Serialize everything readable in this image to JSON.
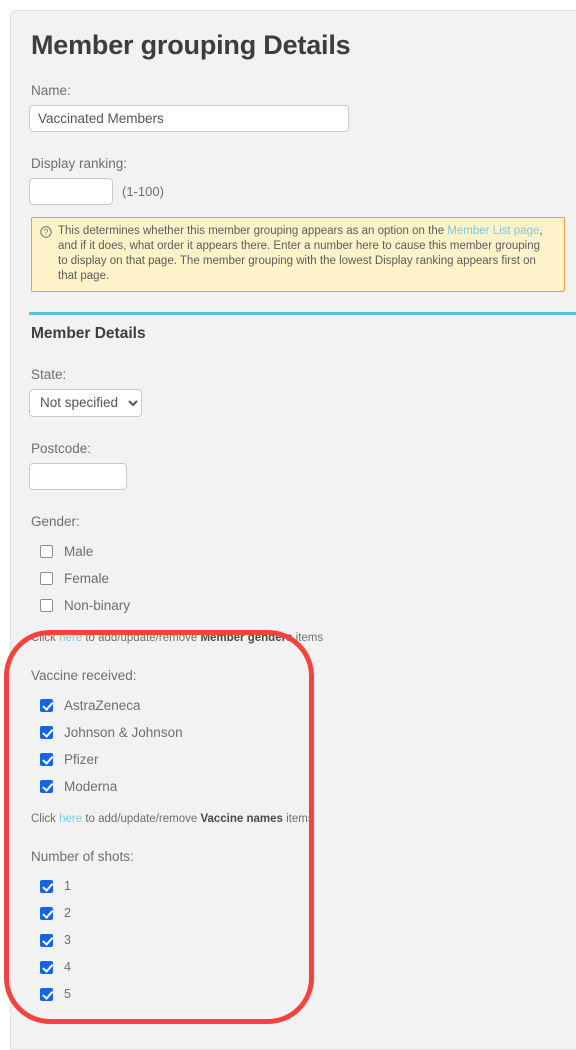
{
  "page": {
    "title": "Member grouping Details"
  },
  "name_field": {
    "label": "Name:",
    "value": "Vaccinated Members",
    "placeholder": ""
  },
  "ranking_field": {
    "label": "Display ranking:",
    "value": "",
    "placeholder": "",
    "hint": "(1-100)"
  },
  "info_box": {
    "icon": "question-circle-icon",
    "line1_pre": "This determines whether this member grouping appears as an option on the ",
    "link_text": "Member List page",
    "line1_post": ",",
    "line2": "and if it does, what order it appears there. Enter a number here to cause this member grouping",
    "line3": "to display on that page. The member grouping with the lowest Display ranking appears first on that page."
  },
  "member_details": {
    "section_title": "Member Details",
    "state": {
      "label": "State:",
      "selected": "Not specified",
      "options": [
        "Not specified"
      ]
    },
    "postcode": {
      "label": "Postcode:",
      "value": "",
      "placeholder": ""
    },
    "gender": {
      "label": "Gender:",
      "items": [
        {
          "label": "Male",
          "checked": false
        },
        {
          "label": "Female",
          "checked": false
        },
        {
          "label": "Non-binary",
          "checked": false
        }
      ],
      "click_line": {
        "pre": "Click ",
        "link": "here",
        "mid": " to add/update/remove ",
        "bold": "Member genders",
        "post": " items"
      }
    },
    "vaccine": {
      "label": "Vaccine received:",
      "items": [
        {
          "label": "AstraZeneca",
          "checked": true
        },
        {
          "label": "Johnson & Johnson",
          "checked": true
        },
        {
          "label": "Pfizer",
          "checked": true
        },
        {
          "label": "Moderna",
          "checked": true
        }
      ],
      "click_line": {
        "pre": "Click ",
        "link": "here",
        "mid": " to add/update/remove ",
        "bold": "Vaccine names",
        "post": " items"
      }
    },
    "shots": {
      "label": "Number of shots:",
      "items": [
        {
          "label": "1",
          "checked": true
        },
        {
          "label": "2",
          "checked": true
        },
        {
          "label": "3",
          "checked": true
        },
        {
          "label": "4",
          "checked": true
        },
        {
          "label": "5",
          "checked": true
        }
      ]
    }
  },
  "annotation": {
    "shape": "rounded-rectangle-highlight",
    "color": "#f4433c"
  },
  "colors": {
    "accent_blue": "#5bc0de",
    "link_blue": "#7ec9e3",
    "checkbox_blue": "#1565e0",
    "info_bg": "#fdf2c8",
    "info_border": "#e8a33d",
    "card_bg": "#f2f2f2",
    "annotation_red": "#f4433c"
  }
}
